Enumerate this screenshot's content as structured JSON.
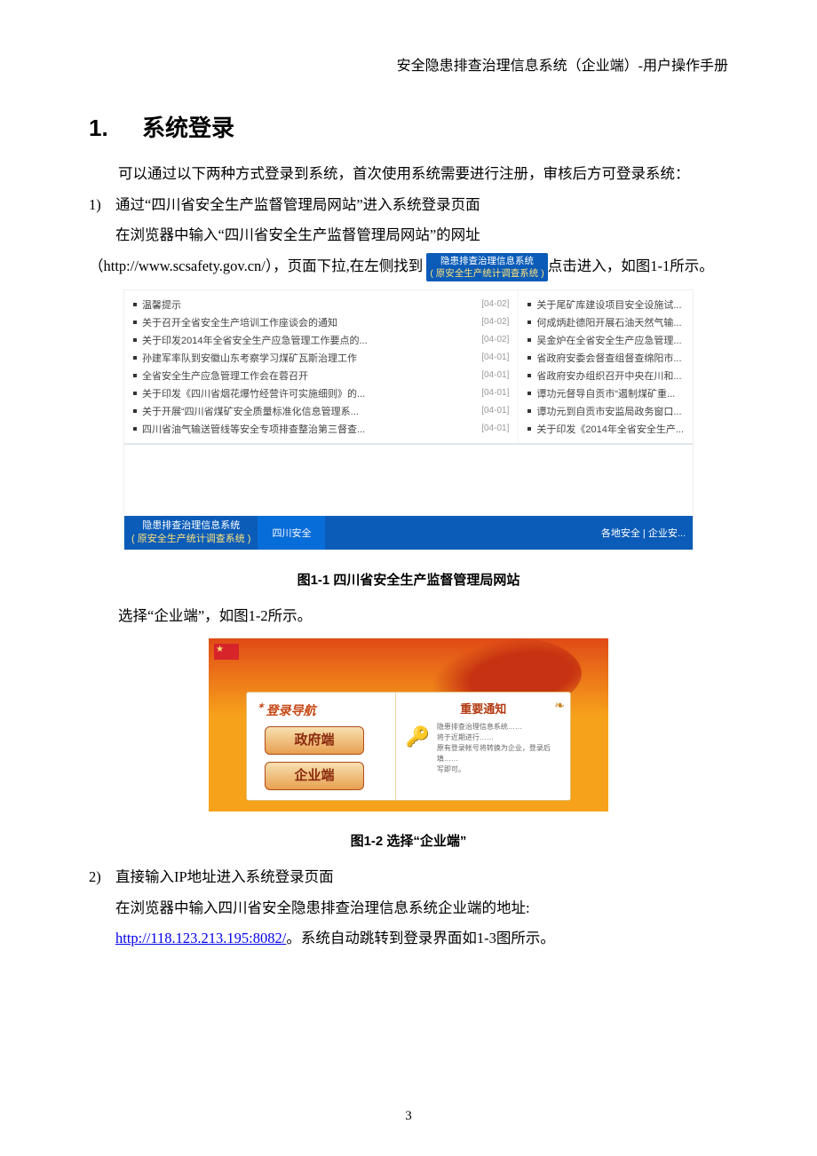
{
  "header": "安全隐患排查治理信息系统（企业端）-用户操作手册",
  "h1_num": "1.",
  "h1_text": "系统登录",
  "p1": "可以通过以下两种方式登录到系统，首次使用系统需要进行注册，审核后方可登录系统：",
  "item1_num": "1)",
  "item1_title": "通过“四川省安全生产监督管理局网站”进入系统登录页面",
  "item1_p1": "在浏览器中输入“四川省安全生产监督管理局网站”的网址",
  "item1_p2a": "（http://www.scsafety.gov.cn/），页面下拉,在左侧找到",
  "badge_line1": "隐患排查治理信息系统",
  "badge_line2": "( 原安全生产统计调查系统 )",
  "item1_p2b": "点击进入，如图1-1所示。",
  "shot1": {
    "left": [
      {
        "t": "温馨提示",
        "d": "[04-02]"
      },
      {
        "t": "关于召开全省安全生产培训工作座谈会的通知",
        "d": "[04-02]"
      },
      {
        "t": "关于印发2014年全省安全生产应急管理工作要点的...",
        "d": "[04-02]"
      },
      {
        "t": "孙建军率队到安徽山东考察学习煤矿瓦斯治理工作",
        "d": "[04-01]"
      },
      {
        "t": "全省安全生产应急管理工作会在蓉召开",
        "d": "[04-01]"
      },
      {
        "t": "关于印发《四川省烟花爆竹经营许可实施细则》的...",
        "d": "[04-01]"
      },
      {
        "t": "关于开展“四川省煤矿安全质量标准化信息管理系...",
        "d": "[04-01]"
      },
      {
        "t": "四川省油气输送管线等安全专项排查整治第三督查...",
        "d": "[04-01]"
      }
    ],
    "right": [
      {
        "t": "关于尾矿库建设项目安全设施试..."
      },
      {
        "t": "何成炳赴德阳开展石油天然气输..."
      },
      {
        "t": "吴金炉在全省安全生产应急管理..."
      },
      {
        "t": "省政府安委会督查组督查绵阳市..."
      },
      {
        "t": "省政府安办组织召开中央在川和..."
      },
      {
        "t": "谭功元督导自贡市“遏制煤矿重..."
      },
      {
        "t": "谭功元到自贡市安监局政务窗口..."
      },
      {
        "t": "关于印发《2014年全省安全生产..."
      }
    ],
    "bar_badge1": "隐患排查治理信息系统",
    "bar_badge2": "( 原安全生产统计调查系统 )",
    "bar_mid": "四川安全",
    "bar_right": "各地安全 | 企业安..."
  },
  "caption1": "图1-1 四川省安全生产监督管理局网站",
  "p_choose": "选择“企业端”，如图1-2所示。",
  "shot2": {
    "nav_title_mini": "✶",
    "nav_title": "登录导航",
    "btn_gov": "政府端",
    "btn_ent": "企业端",
    "notice_title": "重要通知",
    "notice_line1": "隐患排查治理信息系统……",
    "notice_line2": "将于近期进行……",
    "notice_line3": "原有登录帐号将转换为企业，登录后填……",
    "notice_line4": "写即可。"
  },
  "caption2": "图1-2 选择“企业端”",
  "item2_num": "2)",
  "item2_title": "直接输入IP地址进入系统登录页面",
  "item2_p1": "在浏览器中输入四川省安全隐患排查治理信息系统企业端的地址:",
  "item2_link": "http://118.123.213.195:8082/",
  "item2_p2": "。系统自动跳转到登录界面如1-3图所示。",
  "page_number": "3"
}
